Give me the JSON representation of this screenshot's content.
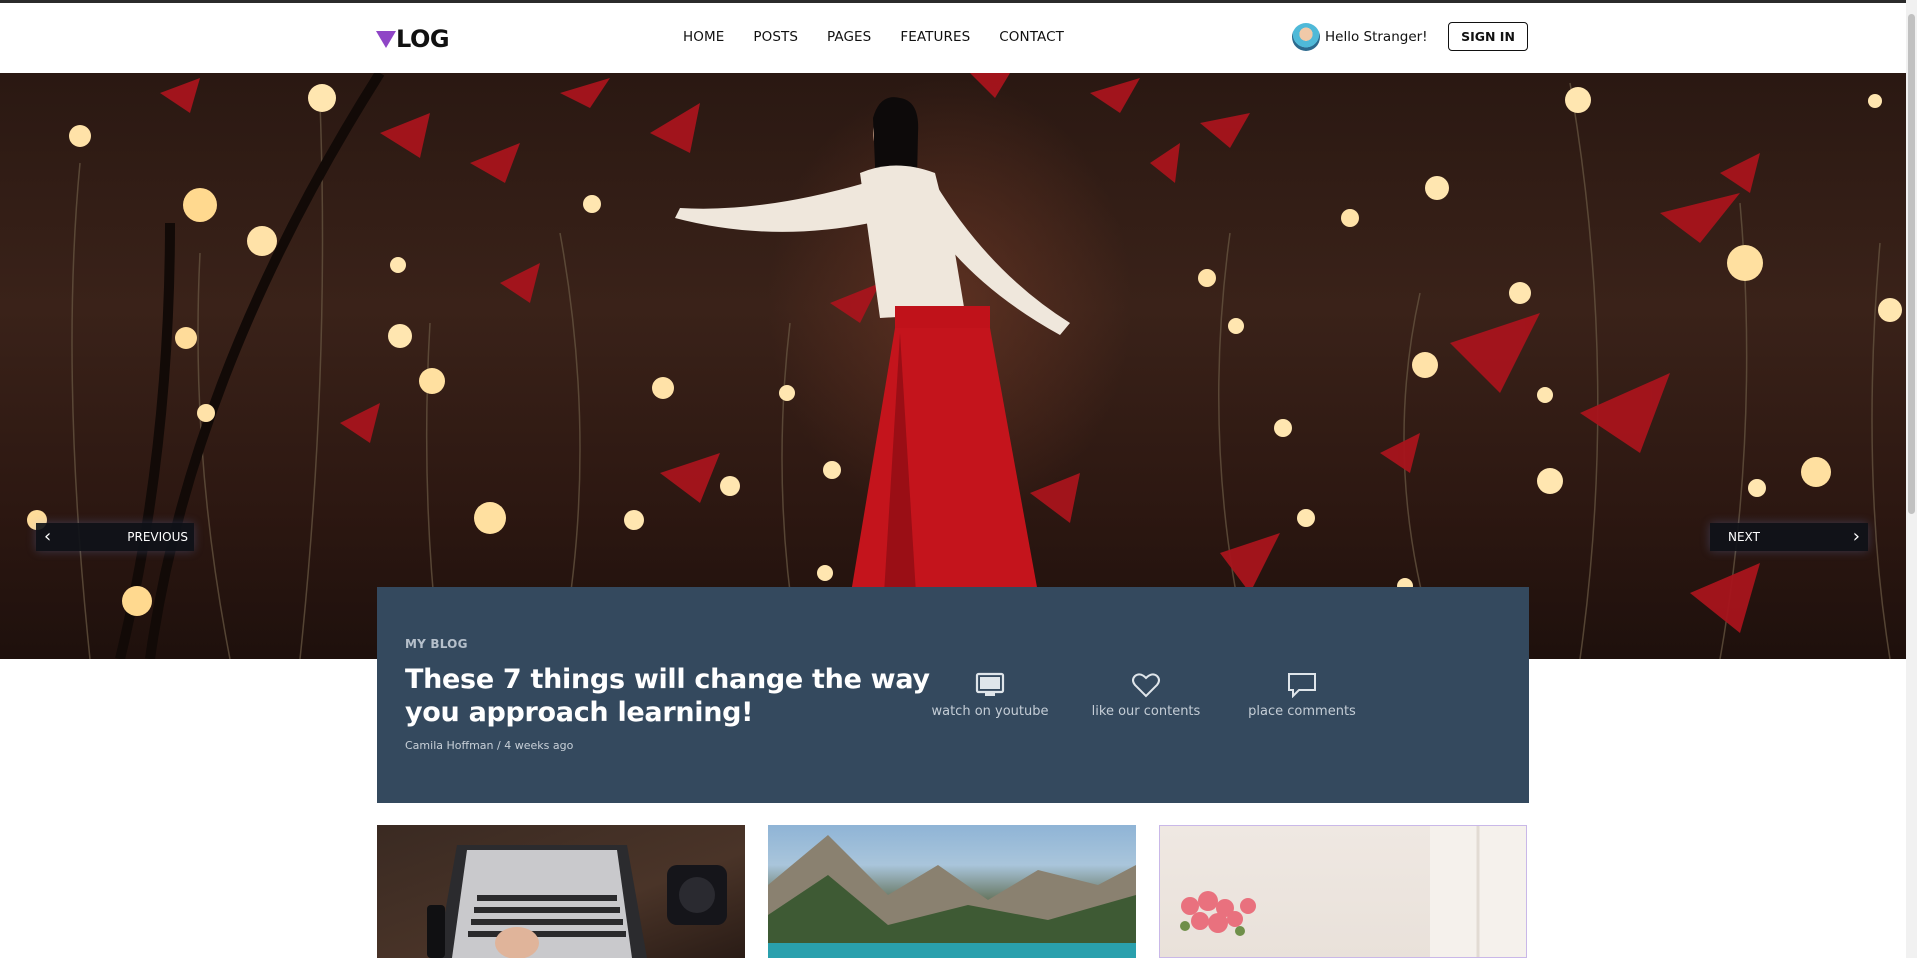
{
  "header": {
    "logo_text": "LOG",
    "logo_color": "#8f45c6",
    "nav": [
      "HOME",
      "POSTS",
      "PAGES",
      "FEATURES",
      "CONTACT"
    ],
    "greeting": "Hello Stranger!",
    "sign_in": "SIGN IN"
  },
  "slider": {
    "previous_label": "PREVIOUS",
    "next_label": "NEXT"
  },
  "featured": {
    "category": "MY BLOG",
    "title": "These 7 things will change the way you approach learning!",
    "author": "Camila Hoffman",
    "separator": "/",
    "time": "4 weeks ago",
    "card_color": "#34495e",
    "actions": [
      {
        "icon": "monitor-icon",
        "label": "watch on youtube"
      },
      {
        "icon": "heart-icon",
        "label": "like our contents"
      },
      {
        "icon": "comment-icon",
        "label": "place comments"
      }
    ]
  },
  "thumbnails": [
    "laptop-photo",
    "mountain-lake-photo",
    "flowers-photo"
  ]
}
